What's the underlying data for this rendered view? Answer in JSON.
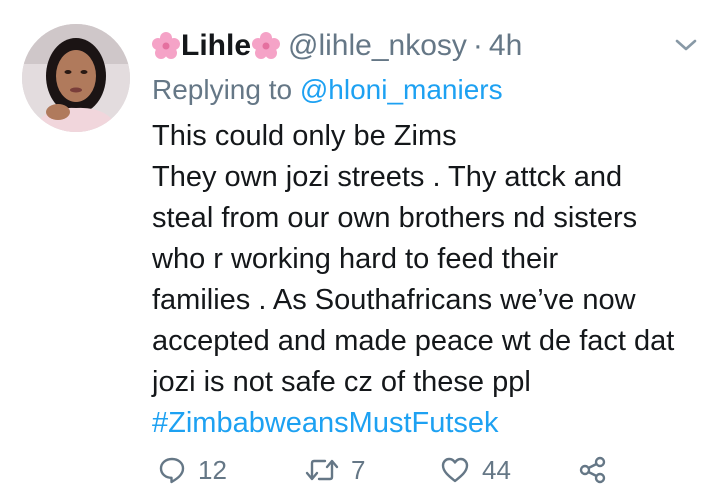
{
  "tweet": {
    "display_name": "Lihle",
    "display_name_decoration": "pink-flower-emoji",
    "handle": "@lihle_nkosy",
    "separator": "·",
    "time": "4h",
    "reply_prefix": "Replying to",
    "reply_to": "@hloni_maniers",
    "body_lines": [
      "This could only be Zims",
      "They own jozi streets . Thy attck and",
      "steal from our own brothers nd sisters",
      "who r working hard to feed their",
      "families . As Southafricans we’ve now",
      "accepted and made peace wt de fact dat",
      "jozi is not safe cz of these ppl"
    ],
    "hashtag": "#ZimbabweansMustFutsek"
  },
  "actions": {
    "reply_count": "12",
    "retweet_count": "7",
    "like_count": "44"
  },
  "icons": {
    "caret": "chevron-down-icon",
    "reply": "reply-icon",
    "retweet": "retweet-icon",
    "like": "heart-icon",
    "share": "share-icon"
  },
  "colors": {
    "text": "#14171a",
    "secondary": "#657786",
    "link": "#1da1f2",
    "flower": "#f5a3c7"
  }
}
